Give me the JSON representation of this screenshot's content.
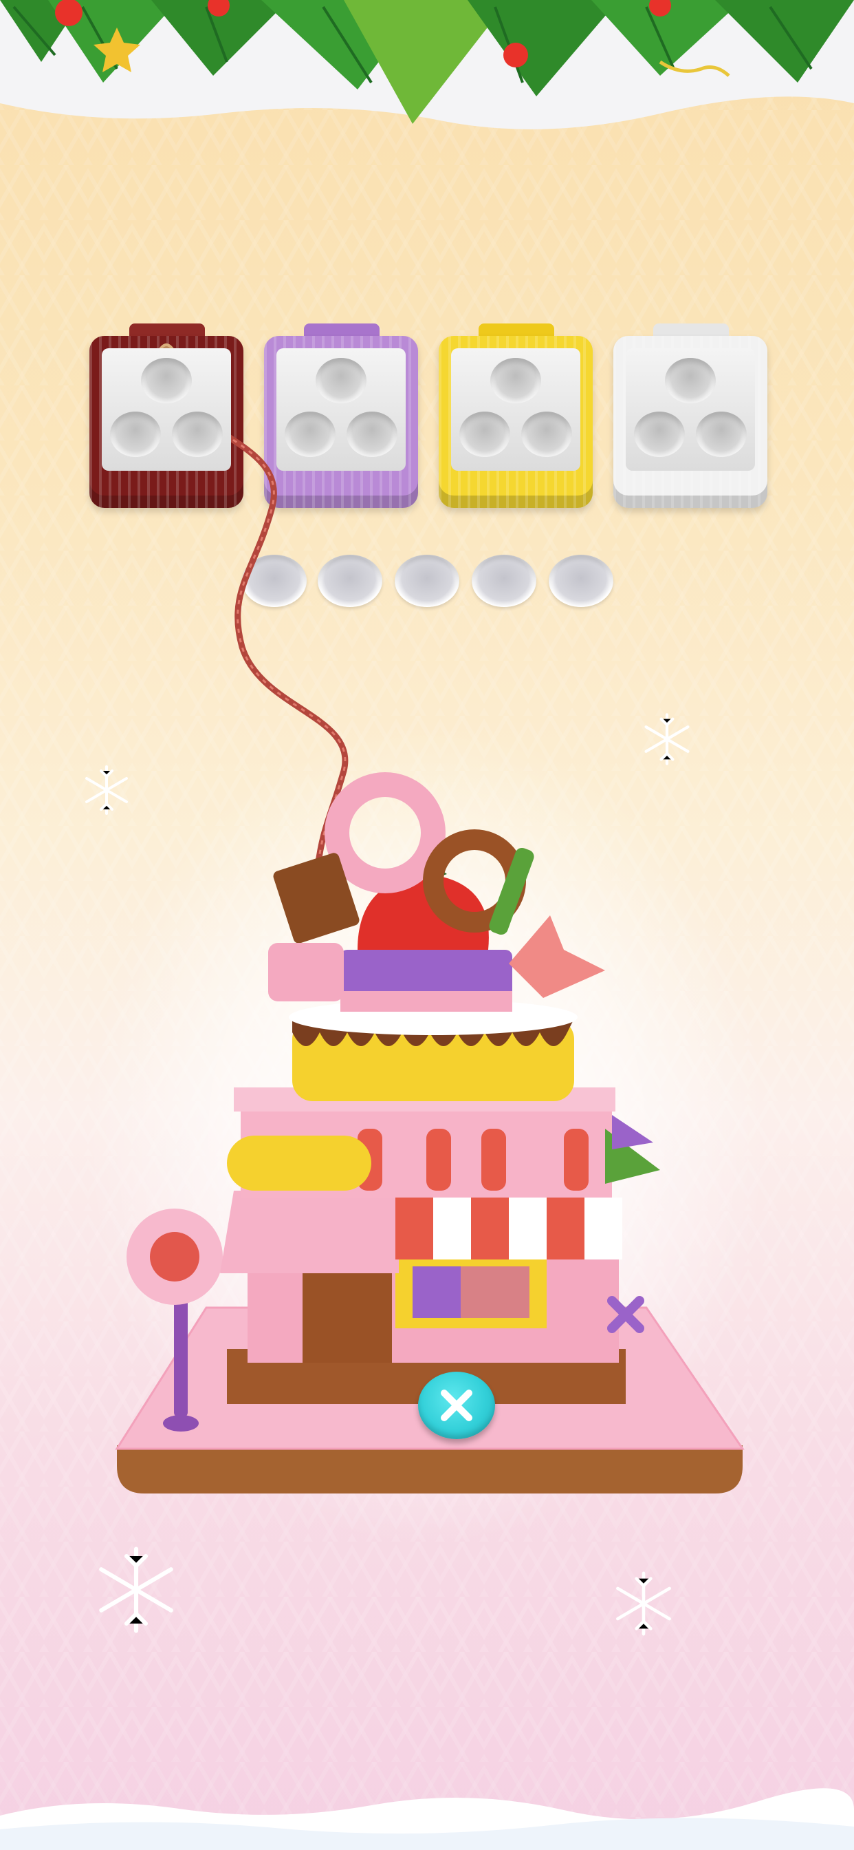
{
  "theme": {
    "accent": "#33d0d9",
    "sky_top": "#f9dfae",
    "sky_bottom": "#f5d1e3"
  },
  "game": {
    "yarn_boxes": [
      {
        "color_name": "brown",
        "color": "#7a1b1a",
        "handle": "#8f2a26",
        "active": true
      },
      {
        "color_name": "purple",
        "color": "#b98ad6",
        "handle": "#a874cc",
        "active": false
      },
      {
        "color_name": "yellow",
        "color": "#f5d730",
        "handle": "#eec91b",
        "active": false
      },
      {
        "color_name": "white",
        "color": "#f2f2f2",
        "handle": "#e6e6e6",
        "active": false
      }
    ],
    "slots_per_box": 3,
    "holding_tray_slots": 5,
    "center_button_icon": "x-icon"
  },
  "decor": {
    "garland_icon": "holly-garland-icon",
    "snowflake_icon": "snowflake-icon",
    "scene_icon": "knitted-cake-shop-icon"
  }
}
